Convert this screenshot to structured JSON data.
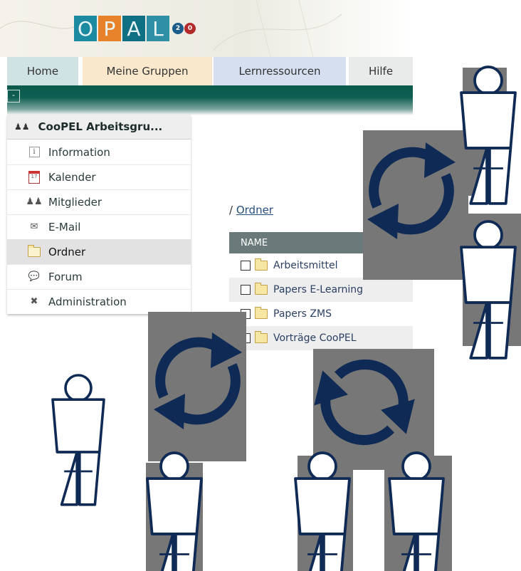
{
  "logo": {
    "letters": [
      "O",
      "P",
      "A",
      "L"
    ],
    "badge": [
      "2",
      "0"
    ]
  },
  "tabs": {
    "home": "Home",
    "groups": "Meine Gruppen",
    "resources": "Lernressourcen",
    "help": "Hilfe"
  },
  "collapse_symbol": "-",
  "sidebar": {
    "group_title": "CooPEL Arbeitsgru...",
    "items": [
      {
        "label": "Information",
        "icon": "info-icon"
      },
      {
        "label": "Kalender",
        "icon": "calendar-icon"
      },
      {
        "label": "Mitglieder",
        "icon": "members-icon"
      },
      {
        "label": "E-Mail",
        "icon": "mail-icon"
      },
      {
        "label": "Ordner",
        "icon": "folder-icon"
      },
      {
        "label": "Forum",
        "icon": "forum-icon"
      },
      {
        "label": "Administration",
        "icon": "tools-icon"
      }
    ]
  },
  "breadcrumb": {
    "prefix": "/",
    "link": "Ordner"
  },
  "folders": {
    "column_header": "NAME",
    "rows": [
      "Arbeitsmittel",
      "Papers E-Learning",
      "Papers ZMS",
      "Vorträge CooPEL"
    ]
  },
  "colors": {
    "teal": "#0b5a4b",
    "navy_arrows": "#0f2a55",
    "gray_panels": "#777777"
  }
}
